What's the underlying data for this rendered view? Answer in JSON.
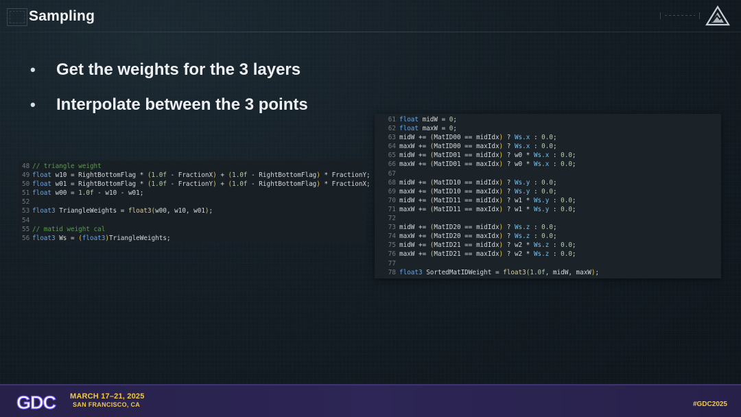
{
  "slide": {
    "title": "Sampling"
  },
  "bullets": [
    "Get the weights for the 3 layers",
    "Interpolate between the 3 points"
  ],
  "code_left": {
    "lines": [
      {
        "n": "48",
        "code": "// triangle weight"
      },
      {
        "n": "49",
        "code": "float w10 = RightBottomFlag * (1.0f - FractionX) + (1.0f - RightBottomFlag) * FractionY;"
      },
      {
        "n": "50",
        "code": "float w01 = RightBottomFlag * (1.0f - FractionY) + (1.0f - RightBottomFlag) * FractionX;"
      },
      {
        "n": "51",
        "code": "float w00 = 1.0f - w10 - w01;"
      },
      {
        "n": "52",
        "code": ""
      },
      {
        "n": "53",
        "code": "float3 TriangleWeights = float3(w00, w10, w01);"
      },
      {
        "n": "54",
        "code": ""
      },
      {
        "n": "55",
        "code": "// matid weight cal"
      },
      {
        "n": "56",
        "code": "float3 Ws = (float3)TriangleWeights;"
      }
    ]
  },
  "code_right": {
    "lines": [
      {
        "n": "61",
        "code": "float midW = 0;"
      },
      {
        "n": "62",
        "code": "float maxW = 0;"
      },
      {
        "n": "63",
        "code": "midW += (MatID00 == midIdx) ? Ws.x : 0.0;"
      },
      {
        "n": "64",
        "code": "maxW += (MatID00 == maxIdx) ? Ws.x : 0.0;"
      },
      {
        "n": "65",
        "code": "midW += (MatID01 == midIdx) ? w0 * Ws.x : 0.0;"
      },
      {
        "n": "66",
        "code": "maxW += (MatID01 == maxIdx) ? w0 * Ws.x : 0.0;"
      },
      {
        "n": "67",
        "code": ""
      },
      {
        "n": "68",
        "code": "midW += (MatID10 == midIdx) ? Ws.y : 0.0;"
      },
      {
        "n": "69",
        "code": "maxW += (MatID10 == maxIdx) ? Ws.y : 0.0;"
      },
      {
        "n": "70",
        "code": "midW += (MatID11 == midIdx) ? w1 * Ws.y : 0.0;"
      },
      {
        "n": "71",
        "code": "maxW += (MatID11 == maxIdx) ? w1 * Ws.y : 0.0;"
      },
      {
        "n": "72",
        "code": ""
      },
      {
        "n": "73",
        "code": "midW += (MatID20 == midIdx) ? Ws.z : 0.0;"
      },
      {
        "n": "74",
        "code": "maxW += (MatID20 == maxIdx) ? Ws.z : 0.0;"
      },
      {
        "n": "75",
        "code": "midW += (MatID21 == midIdx) ? w2 * Ws.z : 0.0;"
      },
      {
        "n": "76",
        "code": "maxW += (MatID21 == maxIdx) ? w2 * Ws.z : 0.0;"
      },
      {
        "n": "77",
        "code": ""
      },
      {
        "n": "78",
        "code": "float3 SortedMatIDWeight = float3(1.0f, midW, maxW);"
      }
    ]
  },
  "footer": {
    "logo_text": "GDC",
    "date": "MARCH 17–21, 2025",
    "location": "SAN FRANCISCO, CA",
    "hashtag": "#GDC2025"
  },
  "colors": {
    "accent_yellow": "#f4c842",
    "footer_bg": "#2a2350",
    "code_keyword": "#64a6ea",
    "code_comment": "#5e9a55",
    "code_number": "#b5cea8"
  },
  "icons": {
    "corner_logo": "triangle-mountain-logo",
    "title_decoration": "square-frame-icon"
  }
}
